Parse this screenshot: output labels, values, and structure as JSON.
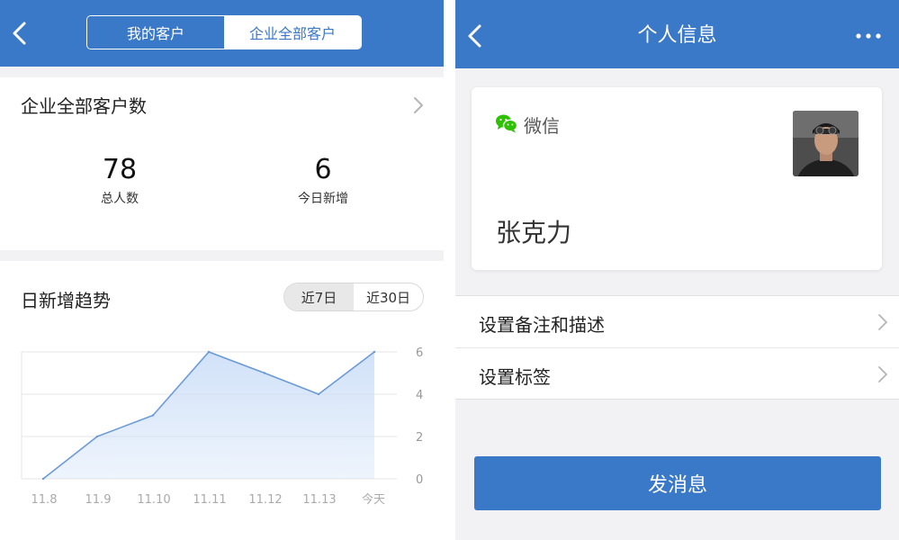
{
  "left": {
    "header": {
      "tabs": [
        {
          "label": "我的客户",
          "active": false
        },
        {
          "label": "企业全部客户",
          "active": true
        }
      ]
    },
    "summary": {
      "title": "企业全部客户数",
      "total": {
        "value": "78",
        "label": "总人数"
      },
      "today": {
        "value": "6",
        "label": "今日新增"
      }
    },
    "trend": {
      "title": "日新增趋势",
      "ranges": [
        {
          "label": "近7日",
          "active": true
        },
        {
          "label": "近30日",
          "active": false
        }
      ]
    }
  },
  "right": {
    "header": {
      "title": "个人信息"
    },
    "profile": {
      "platform_label": "微信",
      "platform_icon": "wechat-icon",
      "name": "张克力"
    },
    "menu": [
      {
        "label": "设置备注和描述"
      },
      {
        "label": "设置标签"
      }
    ],
    "send_button": "发消息"
  },
  "colors": {
    "primary": "#3a78c8",
    "chart_line": "#6a9ad8",
    "chart_fill": "#cfe0f8",
    "wechat_green": "#2dc100"
  },
  "chart_data": {
    "type": "area",
    "categories": [
      "11.8",
      "11.9",
      "11.10",
      "11.11",
      "11.12",
      "11.13",
      "今天"
    ],
    "values": [
      0,
      2,
      3,
      6,
      5,
      4,
      6
    ],
    "yticks": [
      0,
      2,
      4,
      6
    ],
    "ylim": [
      0,
      6
    ],
    "grid": true
  }
}
